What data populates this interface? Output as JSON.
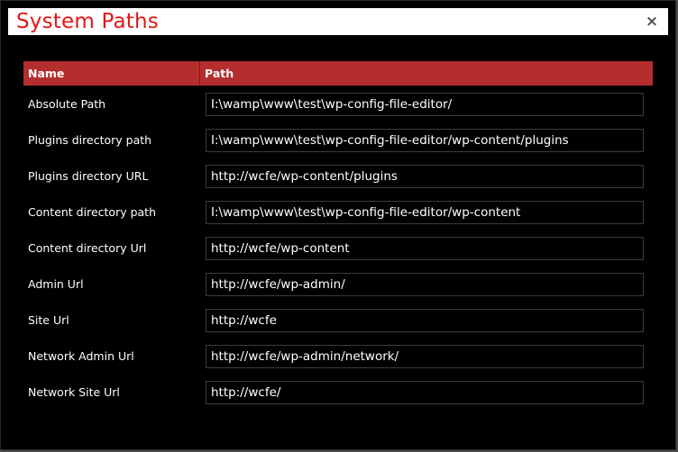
{
  "dialog": {
    "title": "System Paths",
    "close_label": "×"
  },
  "table": {
    "headers": {
      "name": "Name",
      "path": "Path"
    },
    "rows": [
      {
        "label": "Absolute Path",
        "value": "I:\\wamp\\www\\test\\wp-config-file-editor/"
      },
      {
        "label": "Plugins directory path",
        "value": "I:\\wamp\\www\\test\\wp-config-file-editor/wp-content/plugins"
      },
      {
        "label": "Plugins directory URL",
        "value": "http://wcfe/wp-content/plugins"
      },
      {
        "label": "Content directory path",
        "value": "I:\\wamp\\www\\test\\wp-config-file-editor/wp-content"
      },
      {
        "label": "Content directory Url",
        "value": "http://wcfe/wp-content"
      },
      {
        "label": "Admin Url",
        "value": "http://wcfe/wp-admin/"
      },
      {
        "label": "Site Url",
        "value": "http://wcfe"
      },
      {
        "label": "Network Admin Url",
        "value": "http://wcfe/wp-admin/network/"
      },
      {
        "label": "Network Site Url",
        "value": "http://wcfe/"
      }
    ]
  },
  "colors": {
    "title": "#e01818",
    "header_bg": "#b42e2e",
    "background": "#000000"
  }
}
